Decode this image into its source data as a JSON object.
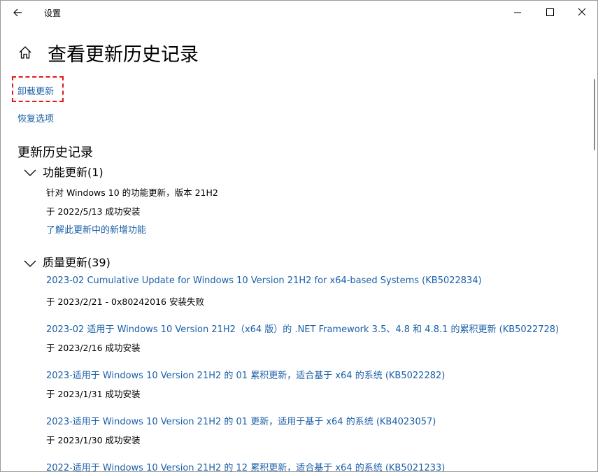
{
  "window": {
    "title": "设置"
  },
  "page": {
    "title": "查看更新历史记录"
  },
  "actions": {
    "uninstall": "卸载更新",
    "recovery": "恢复选项"
  },
  "history": {
    "heading": "更新历史记录",
    "feature": {
      "title": "功能更新(1)",
      "item_name": "针对 Windows 10 的功能更新，版本 21H2",
      "item_status": "于 2022/5/13 成功安装",
      "learn_more": "了解此更新中的新增功能"
    },
    "quality": {
      "title": "质量更新(39)",
      "items": [
        {
          "name": "2023-02 Cumulative Update for Windows 10 Version 21H2 for x64-based Systems (KB5022834)",
          "status": "于 2023/2/21 - 0x80242016 安装失败"
        },
        {
          "name": "2023-02 适用于 Windows 10 Version 21H2（x64 版）的 .NET Framework 3.5、4.8 和 4.8.1 的累积更新 (KB5022728)",
          "status": "于 2023/2/16 成功安装"
        },
        {
          "name": "2023-适用于 Windows 10 Version 21H2 的 01 累积更新，适合基于 x64 的系统 (KB5022282)",
          "status": "于 2023/1/31 成功安装"
        },
        {
          "name": "2023-适用于 Windows 10 Version 21H2 的 01 更新，适用于基于 x64 的系统 (KB4023057)",
          "status": "于 2023/1/30 成功安装"
        },
        {
          "name": "2022-适用于 Windows 10 Version 21H2 的 12 累积更新，适合基于 x64 的系统 (KB5021233)",
          "status": ""
        }
      ]
    }
  },
  "icons": {
    "back": "back-arrow-icon",
    "home": "home-icon",
    "minimize": "minimize-icon",
    "maximize": "maximize-icon",
    "close": "close-icon",
    "expand": "chevron-down-icon"
  },
  "colors": {
    "link": "#1a5fa8",
    "highlight": "#e31a1a"
  }
}
